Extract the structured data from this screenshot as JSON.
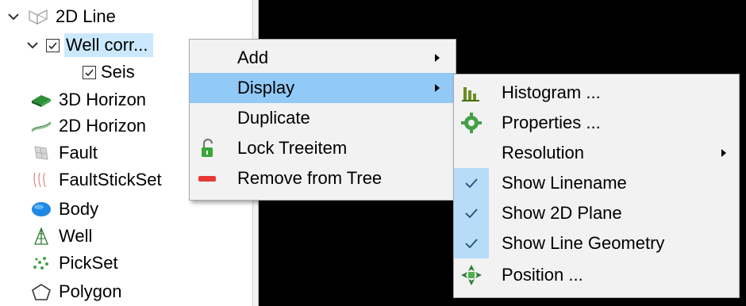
{
  "tree": {
    "items": [
      {
        "label": "2D Line",
        "icon": "2d-line-icon"
      },
      {
        "label": "Well corr...",
        "icon": "checkbox",
        "checked": true
      },
      {
        "label": "Seis",
        "icon": "checkbox",
        "checked": true
      },
      {
        "label": "3D Horizon",
        "icon": "3d-horizon-icon"
      },
      {
        "label": "2D Horizon",
        "icon": "2d-horizon-icon"
      },
      {
        "label": "Fault",
        "icon": "fault-icon"
      },
      {
        "label": "FaultStickSet",
        "icon": "faultstickset-icon"
      },
      {
        "label": "Body",
        "icon": "body-icon"
      },
      {
        "label": "Well",
        "icon": "well-icon"
      },
      {
        "label": "PickSet",
        "icon": "pickset-icon"
      },
      {
        "label": "Polygon",
        "icon": "polygon-icon"
      }
    ]
  },
  "context_menu": {
    "items": [
      {
        "label": "Add",
        "submenu": true
      },
      {
        "label": "Display",
        "submenu": true,
        "highlighted": true
      },
      {
        "label": "Duplicate"
      },
      {
        "label": "Lock Treeitem",
        "icon": "lock-icon"
      },
      {
        "label": "Remove from Tree",
        "icon": "remove-icon"
      }
    ]
  },
  "display_submenu": {
    "items": [
      {
        "label": "Histogram ...",
        "icon": "histogram-icon"
      },
      {
        "label": "Properties ...",
        "icon": "gear-icon"
      },
      {
        "label": "Resolution",
        "submenu": true
      },
      {
        "label": "Show Linename",
        "checked": true
      },
      {
        "label": "Show 2D Plane",
        "checked": true
      },
      {
        "label": "Show Line Geometry",
        "checked": true
      },
      {
        "label": "Position ...",
        "icon": "position-icon"
      }
    ]
  },
  "colors": {
    "menu_highlight": "#91c9f7",
    "tree_selection": "#cce8ff",
    "viewer_background": "#000000"
  }
}
